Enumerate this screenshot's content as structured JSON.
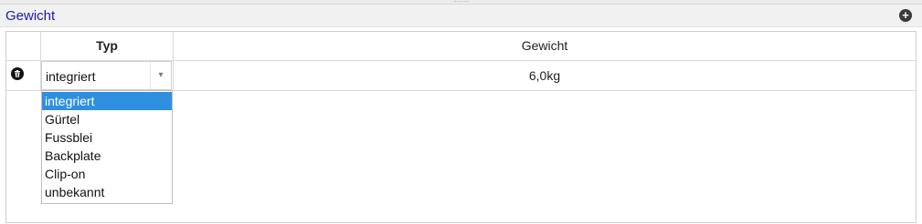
{
  "panel": {
    "title": "Gewicht",
    "add_icon": "plus-circle-icon",
    "add_glyph": "+"
  },
  "table": {
    "headers": {
      "blank": "",
      "typ": "Typ",
      "gewicht": "Gewicht"
    },
    "rows": [
      {
        "delete_icon": "trash-icon",
        "typ": "integriert",
        "gewicht": "6,0kg"
      }
    ]
  },
  "dropdown": {
    "arrow_glyph": "▾",
    "selected": "integriert",
    "options": [
      "integriert",
      "Gürtel",
      "Fussblei",
      "Backplate",
      "Clip-on",
      "unbekannt"
    ]
  },
  "colors": {
    "title": "#1a1aa6",
    "selection": "#2e8fe0"
  }
}
